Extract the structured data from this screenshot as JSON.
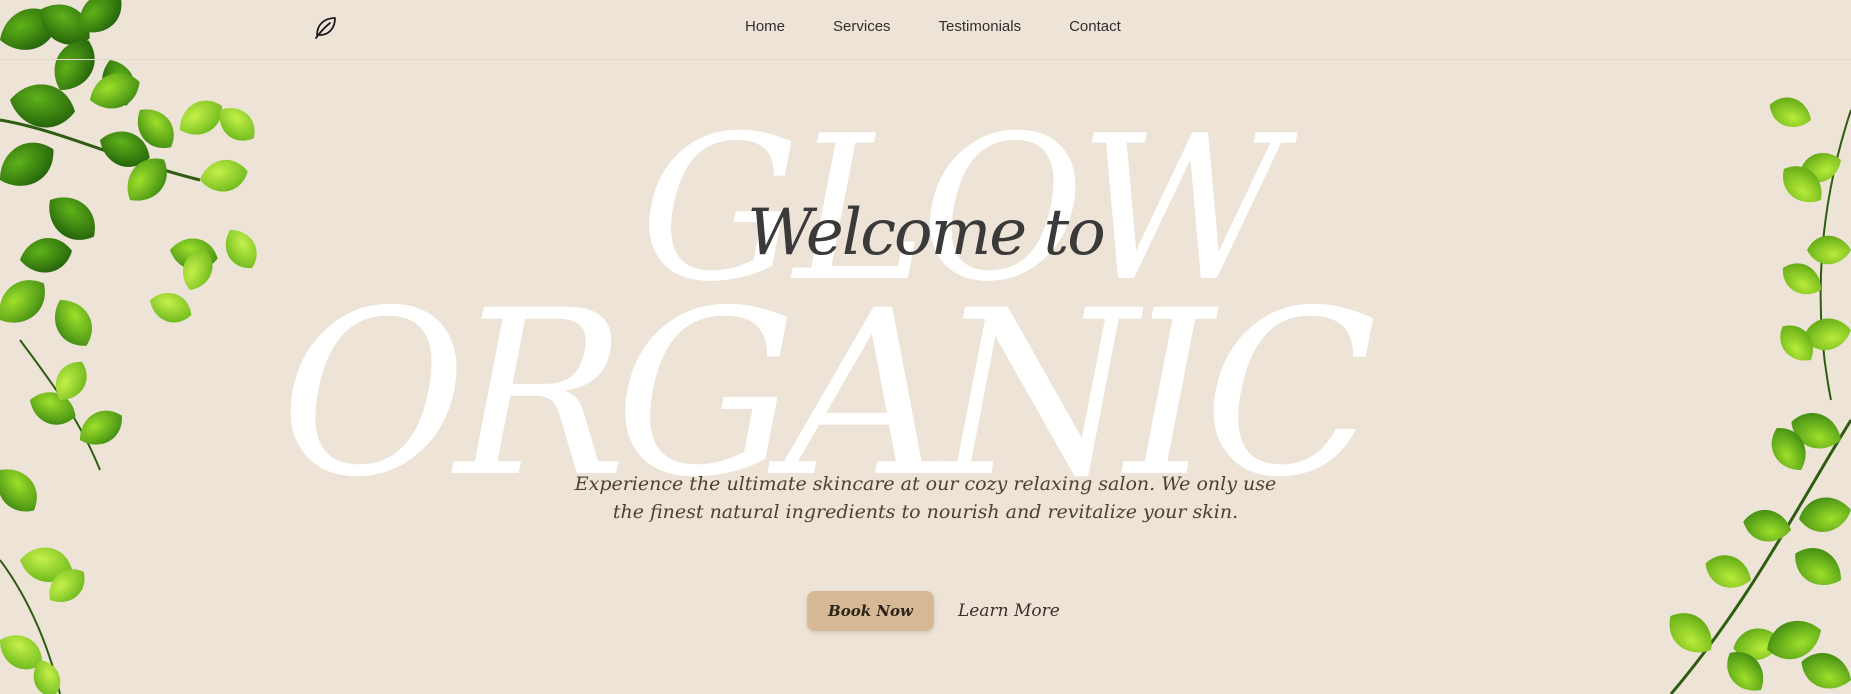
{
  "header": {
    "logo_icon": "leaf-icon",
    "nav": [
      {
        "label": "Home"
      },
      {
        "label": "Services"
      },
      {
        "label": "Testimonials"
      },
      {
        "label": "Contact"
      }
    ]
  },
  "hero": {
    "bg_word_top": "GLOW",
    "bg_word_bottom": "ORGANIC",
    "welcome": "Welcome to",
    "description_line1": "Experience the ultimate skincare at our cozy relaxing salon. We only use",
    "description_line2": "the finest natural ingredients to nourish and revitalize your skin.",
    "primary_button": "Book Now",
    "secondary_link": "Learn More"
  },
  "colors": {
    "background": "#ede3d6",
    "accent": "#d6b894",
    "leaf_dark": "#3f8a12",
    "leaf_light": "#8cd61c"
  }
}
